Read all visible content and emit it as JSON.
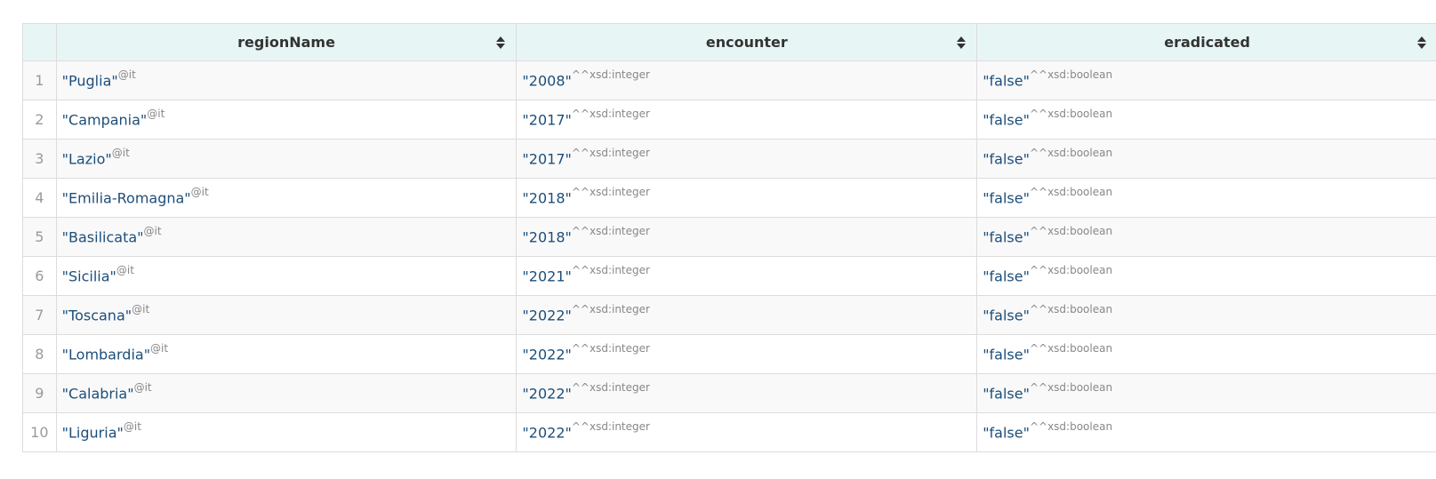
{
  "columns": [
    {
      "label": "regionName"
    },
    {
      "label": "encounter"
    },
    {
      "label": "eradicated"
    }
  ],
  "rows": [
    {
      "n": "1",
      "region": "\"Puglia\"",
      "region_tag": "@it",
      "encounter": "\"2008\"",
      "enc_type": "^^xsd:integer",
      "eradicated": "\"false\"",
      "erad_type": "^^xsd:boolean"
    },
    {
      "n": "2",
      "region": "\"Campania\"",
      "region_tag": "@it",
      "encounter": "\"2017\"",
      "enc_type": "^^xsd:integer",
      "eradicated": "\"false\"",
      "erad_type": "^^xsd:boolean"
    },
    {
      "n": "3",
      "region": "\"Lazio\"",
      "region_tag": "@it",
      "encounter": "\"2017\"",
      "enc_type": "^^xsd:integer",
      "eradicated": "\"false\"",
      "erad_type": "^^xsd:boolean"
    },
    {
      "n": "4",
      "region": "\"Emilia-Romagna\"",
      "region_tag": "@it",
      "encounter": "\"2018\"",
      "enc_type": "^^xsd:integer",
      "eradicated": "\"false\"",
      "erad_type": "^^xsd:boolean"
    },
    {
      "n": "5",
      "region": "\"Basilicata\"",
      "region_tag": "@it",
      "encounter": "\"2018\"",
      "enc_type": "^^xsd:integer",
      "eradicated": "\"false\"",
      "erad_type": "^^xsd:boolean"
    },
    {
      "n": "6",
      "region": "\"Sicilia\"",
      "region_tag": "@it",
      "encounter": "\"2021\"",
      "enc_type": "^^xsd:integer",
      "eradicated": "\"false\"",
      "erad_type": "^^xsd:boolean"
    },
    {
      "n": "7",
      "region": "\"Toscana\"",
      "region_tag": "@it",
      "encounter": "\"2022\"",
      "enc_type": "^^xsd:integer",
      "eradicated": "\"false\"",
      "erad_type": "^^xsd:boolean"
    },
    {
      "n": "8",
      "region": "\"Lombardia\"",
      "region_tag": "@it",
      "encounter": "\"2022\"",
      "enc_type": "^^xsd:integer",
      "eradicated": "\"false\"",
      "erad_type": "^^xsd:boolean"
    },
    {
      "n": "9",
      "region": "\"Calabria\"",
      "region_tag": "@it",
      "encounter": "\"2022\"",
      "enc_type": "^^xsd:integer",
      "eradicated": "\"false\"",
      "erad_type": "^^xsd:boolean"
    },
    {
      "n": "10",
      "region": "\"Liguria\"",
      "region_tag": "@it",
      "encounter": "\"2022\"",
      "enc_type": "^^xsd:integer",
      "eradicated": "\"false\"",
      "erad_type": "^^xsd:boolean"
    }
  ],
  "icons": {
    "sort": "sort-up-down-icon"
  },
  "colors": {
    "header_bg": "#e7f6f5",
    "value_text": "#1d4e7a",
    "annotation_text": "#888888"
  }
}
